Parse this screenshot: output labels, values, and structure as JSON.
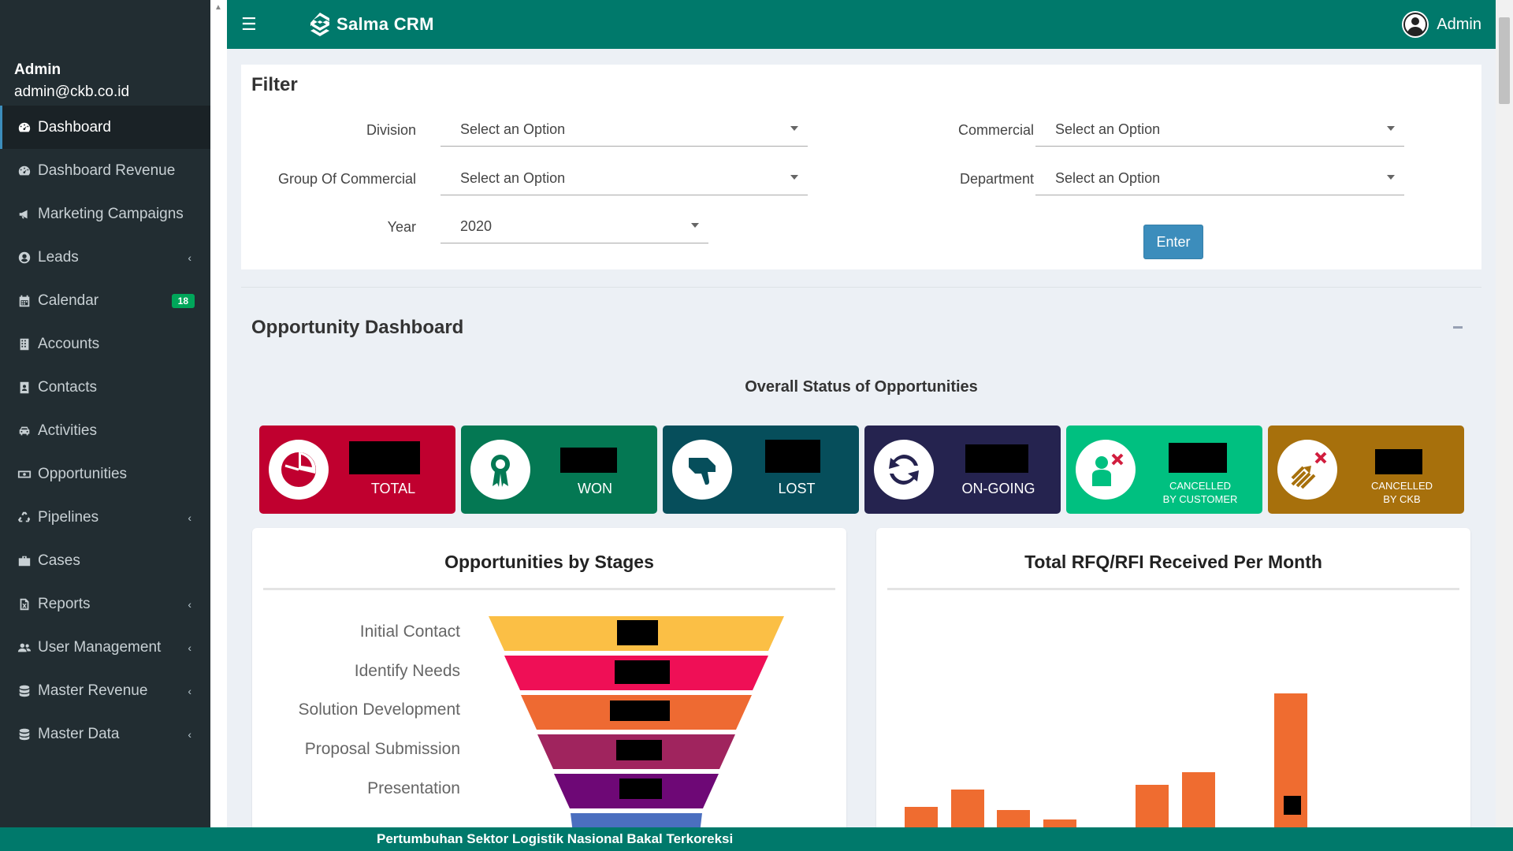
{
  "sidebar": {
    "user_name": "Admin",
    "user_email": "admin@ckb.co.id",
    "items": [
      {
        "label": "Dashboard",
        "icon": "dashboard-icon",
        "active": true
      },
      {
        "label": "Dashboard Revenue",
        "icon": "dashboard-icon"
      },
      {
        "label": "Marketing Campaigns",
        "icon": "bullhorn-icon"
      },
      {
        "label": "Leads",
        "icon": "user-circle-icon",
        "expandable": true
      },
      {
        "label": "Calendar",
        "icon": "calendar-icon",
        "badge": "18"
      },
      {
        "label": "Accounts",
        "icon": "building-icon"
      },
      {
        "label": "Contacts",
        "icon": "address-book-icon"
      },
      {
        "label": "Activities",
        "icon": "car-icon"
      },
      {
        "label": "Opportunities",
        "icon": "money-icon"
      },
      {
        "label": "Pipelines",
        "icon": "recycle-icon",
        "expandable": true
      },
      {
        "label": "Cases",
        "icon": "briefcase-icon"
      },
      {
        "label": "Reports",
        "icon": "file-excel-icon",
        "expandable": true
      },
      {
        "label": "User Management",
        "icon": "users-icon",
        "expandable": true
      },
      {
        "label": "Master Revenue",
        "icon": "database-icon",
        "expandable": true
      },
      {
        "label": "Master Data",
        "icon": "database-icon",
        "expandable": true
      }
    ]
  },
  "header": {
    "brand": "Salma CRM",
    "user": "Admin"
  },
  "filter": {
    "title": "Filter",
    "division_label": "Division",
    "division_value": "Select an Option",
    "group_label": "Group Of Commercial",
    "group_value": "Select an Option",
    "year_label": "Year",
    "year_value": "2020",
    "commercial_label": "Commercial",
    "commercial_value": "Select an Option",
    "department_label": "Department",
    "department_value": "Select an Option",
    "enter_label": "Enter"
  },
  "dashboard": {
    "title": "Opportunity Dashboard",
    "overall_title": "Overall Status of Opportunities",
    "stats": [
      {
        "label": "TOTAL",
        "color": "#c0002f",
        "icon": "pie-chart-icon"
      },
      {
        "label": "WON",
        "color": "#047853",
        "icon": "award-ribbon-icon"
      },
      {
        "label": "LOST",
        "color": "#064e5b",
        "icon": "thumbs-down-icon"
      },
      {
        "label": "ON-GOING",
        "color": "#25234f",
        "icon": "refresh-icon"
      },
      {
        "label_line1": "CANCELLED",
        "label_line2": "BY CUSTOMER",
        "color": "#00c080",
        "icon": "user-cancel-icon"
      },
      {
        "label_line1": "CANCELLED",
        "label_line2": "BY CKB",
        "color": "#a7700c",
        "icon": "arrows-cancel-icon"
      }
    ],
    "funnel_title": "Opportunities by Stages",
    "stages": [
      "Initial Contact",
      "Identify Needs",
      "Solution Development",
      "Proposal Submission",
      "Presentation"
    ],
    "rfq_title": "Total RFQ/RFI Received Per Month"
  },
  "colors": {
    "header": "#00796b",
    "sidebar": "#222d32",
    "funnel": [
      "#fbbf45",
      "#ef0f56",
      "#ee6a32",
      "#a0245e",
      "#6e0876",
      "#4b6fbf"
    ],
    "bar": "#ef6c30"
  },
  "chart_data": {
    "type": "bar",
    "title": "Total RFQ/RFI Received Per Month",
    "series": [
      {
        "values": [
          null,
          null,
          null,
          null,
          null,
          null,
          null,
          null,
          null,
          null
        ]
      }
    ]
  },
  "footer": {
    "ticker": "Pertumbuhan Sektor Logistik Nasional Bakal Terkoreksi"
  }
}
